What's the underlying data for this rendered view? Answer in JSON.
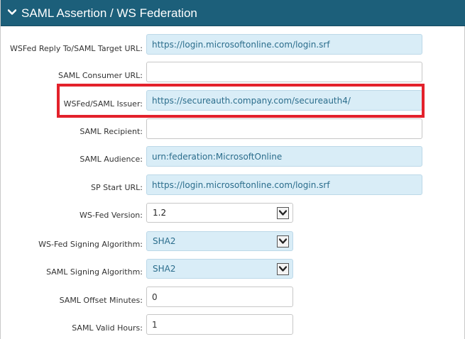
{
  "panel": {
    "title": "SAML Assertion / WS Federation"
  },
  "fields": {
    "wsfed_reply_to": {
      "label": "WSFed Reply To/SAML Target URL:",
      "value": "https://login.microsoftonline.com/login.srf"
    },
    "saml_consumer_url": {
      "label": "SAML Consumer URL:",
      "value": ""
    },
    "wsfed_saml_issuer": {
      "label": "WSFed/SAML Issuer:",
      "value": "https://secureauth.company.com/secureauth4/"
    },
    "saml_recipient": {
      "label": "SAML Recipient:",
      "value": ""
    },
    "saml_audience": {
      "label": "SAML Audience:",
      "value": "urn:federation:MicrosoftOnline"
    },
    "sp_start_url": {
      "label": "SP Start URL:",
      "value": "https://login.microsoftonline.com/login.srf"
    },
    "ws_fed_version": {
      "label": "WS-Fed Version:",
      "value": "1.2"
    },
    "ws_fed_signing_algorithm": {
      "label": "WS-Fed Signing Algorithm:",
      "value": "SHA2"
    },
    "saml_signing_algorithm": {
      "label": "SAML Signing Algorithm:",
      "value": "SHA2"
    },
    "saml_offset_minutes": {
      "label": "SAML Offset Minutes:",
      "value": "0"
    },
    "saml_valid_hours": {
      "label": "SAML Valid Hours:",
      "value": "1"
    }
  },
  "colors": {
    "header_bg": "#1c5f7a",
    "filled_input_bg": "#d9edf7",
    "highlight": "#e3212b"
  },
  "icons": {
    "header_toggle": "chevron-down-icon",
    "select_arrow": "chevron-down-icon"
  }
}
